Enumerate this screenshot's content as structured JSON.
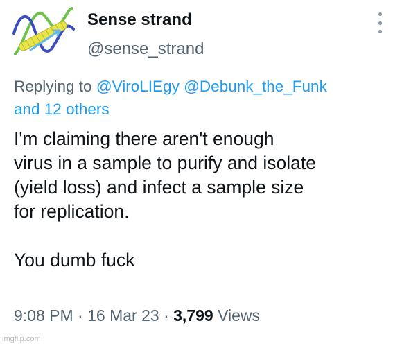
{
  "user": {
    "display_name": "Sense strand",
    "handle": "@sense_strand",
    "avatar_icon": "dna-helix-icon"
  },
  "reply_context": {
    "prefix": "Replying to",
    "mention_1": "@ViroLIEgy",
    "mention_2": "@Debunk_the_Funk",
    "others": "and 12 others"
  },
  "tweet": {
    "text": "I'm claiming there aren't enough\nvirus in a sample to purify and isolate\n(yield loss) and infect a sample size\nfor replication.\n\nYou dumb fuck"
  },
  "meta": {
    "time": "9:08 PM",
    "separator": "·",
    "date": "16 Mar 23",
    "views_count": "3,799",
    "views_label": "Views"
  },
  "watermark": "imgflip.com",
  "colors": {
    "link": "#1d9bf0",
    "secondary_text": "#536471",
    "primary_text": "#0f1419"
  }
}
